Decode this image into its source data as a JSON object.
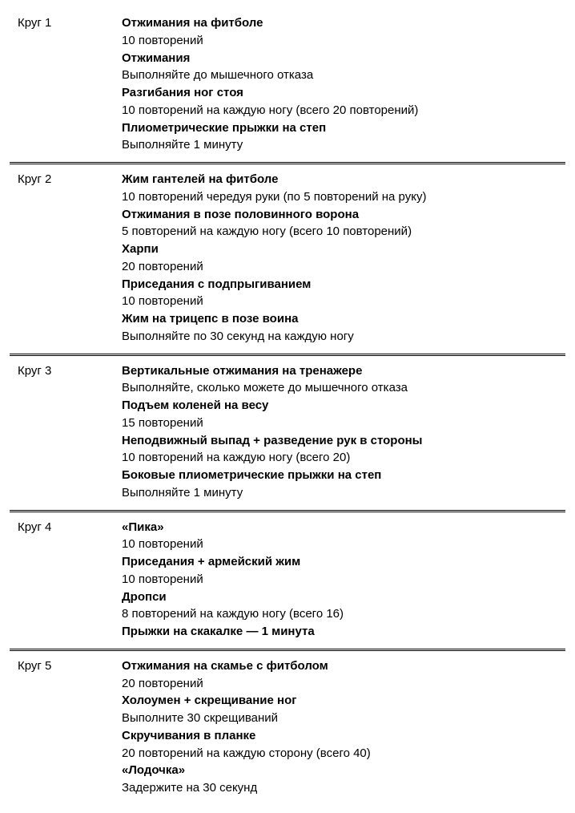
{
  "rounds": [
    {
      "label": "Круг 1",
      "lines": [
        {
          "t": "ex",
          "text": "Отжимания на фитболе"
        },
        {
          "t": "d",
          "text": "10 повторений"
        },
        {
          "t": "ex",
          "text": "Отжимания"
        },
        {
          "t": "d",
          "text": "Выполняйте до мышечного отказа"
        },
        {
          "t": "ex",
          "text": "Разгибания ног стоя"
        },
        {
          "t": "d",
          "text": "10 повторений на каждую ногу (всего 20 повторений)"
        },
        {
          "t": "ex",
          "text": "Плиометрические прыжки на степ"
        },
        {
          "t": "d",
          "text": "Выполняйте 1 минуту"
        }
      ]
    },
    {
      "label": "Круг 2",
      "lines": [
        {
          "t": "ex",
          "text": "Жим гантелей на фитболе"
        },
        {
          "t": "d",
          "text": "10 повторений чередуя руки (по 5 повторений на руку)"
        },
        {
          "t": "ex",
          "text": "Отжимания в позе половинного ворона"
        },
        {
          "t": "d",
          "text": "5 повторений на каждую ногу (всего 10 повторений)"
        },
        {
          "t": "ex",
          "text": "Харпи"
        },
        {
          "t": "d",
          "text": "20 повторений"
        },
        {
          "t": "ex",
          "text": "Приседания с подпрыгиванием"
        },
        {
          "t": "d",
          "text": "10 повторений"
        },
        {
          "t": "ex",
          "text": "Жим на трицепс в позе воина"
        },
        {
          "t": "d",
          "text": "Выполняйте по 30 секунд на каждую ногу"
        }
      ]
    },
    {
      "label": "Круг 3",
      "lines": [
        {
          "t": "ex",
          "text": "Вертикальные отжимания на тренажере"
        },
        {
          "t": "d",
          "text": "Выполняйте, сколько можете до мышечного отказа"
        },
        {
          "t": "ex",
          "text": "Подъем коленей на весу"
        },
        {
          "t": "d",
          "text": "15 повторений"
        },
        {
          "t": "ex",
          "text": "Неподвижный выпад + разведение рук в стороны"
        },
        {
          "t": "d",
          "text": "10 повторений на каждую ногу (всего 20)"
        },
        {
          "t": "ex",
          "text": "Боковые плиометрические прыжки на степ"
        },
        {
          "t": "d",
          "text": "Выполняйте 1 минуту"
        }
      ]
    },
    {
      "label": "Круг 4",
      "lines": [
        {
          "t": "ex",
          "text": "«Пика»"
        },
        {
          "t": "d",
          "text": "10 повторений"
        },
        {
          "t": "ex",
          "text": "Приседания + армейский жим"
        },
        {
          "t": "d",
          "text": "10 повторений"
        },
        {
          "t": "ex",
          "text": "Дропси"
        },
        {
          "t": "d",
          "text": "8 повторений на каждую ногу (всего 16)"
        },
        {
          "t": "ex",
          "text": "Прыжки на скакалке — 1 минута"
        }
      ]
    },
    {
      "label": "Круг 5",
      "lines": [
        {
          "t": "ex",
          "text": "Отжимания на скамье с фитболом"
        },
        {
          "t": "d",
          "text": "20 повторений"
        },
        {
          "t": "ex",
          "text": "Холоумен + скрещивание ног"
        },
        {
          "t": "d",
          "text": "Выполните 30 скрещиваний"
        },
        {
          "t": "ex",
          "text": "Скручивания в планке"
        },
        {
          "t": "d",
          "text": "20 повторений на каждую сторону (всего 40)"
        },
        {
          "t": "ex",
          "text": "«Лодочка»"
        },
        {
          "t": "d",
          "text": "Задержите на 30 секунд"
        }
      ]
    }
  ]
}
